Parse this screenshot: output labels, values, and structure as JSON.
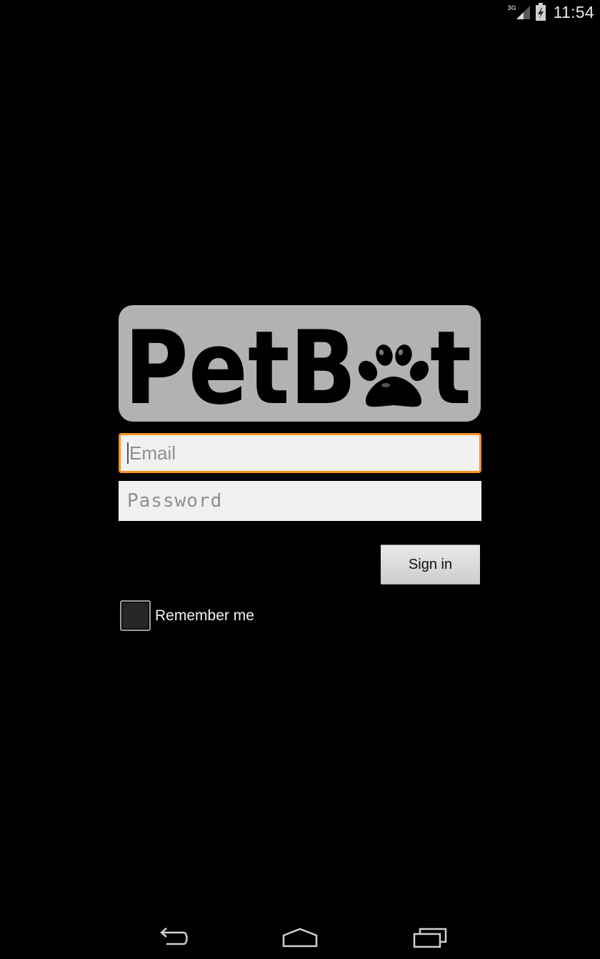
{
  "status_bar": {
    "network_type": "3G",
    "time": "11:54",
    "icons": [
      "signal-icon",
      "battery-icon"
    ]
  },
  "logo": {
    "text": "PetBot",
    "icon": "paw-icon"
  },
  "login_form": {
    "email_placeholder": "Email",
    "email_value": "",
    "password_placeholder": "Password",
    "password_value": "",
    "sign_in_label": "Sign in",
    "remember_label": "Remember me",
    "remember_checked": false
  },
  "nav_bar": {
    "icons": [
      "back-icon",
      "home-icon",
      "recents-icon"
    ]
  },
  "colors": {
    "background": "#000000",
    "logo_background": "#b2b2b2",
    "focus_border": "#f7931e",
    "field_background": "#f1f1f1"
  }
}
